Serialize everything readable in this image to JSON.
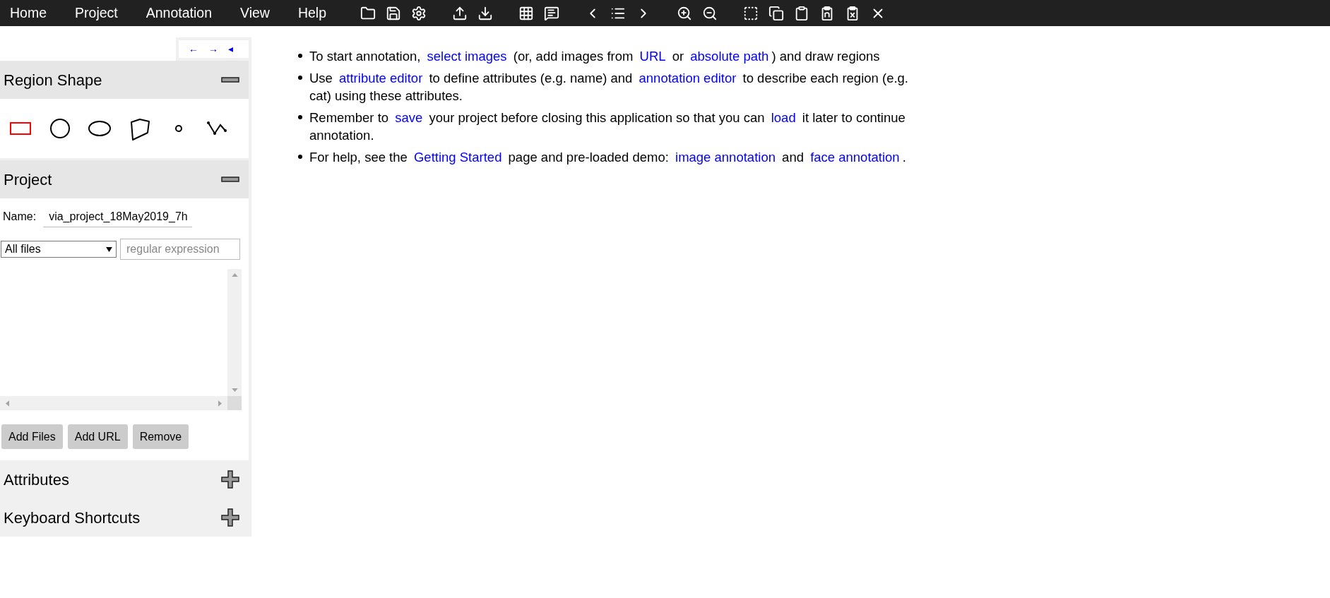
{
  "menu": [
    {
      "label": "Home"
    },
    {
      "label": "Project"
    },
    {
      "label": "Annotation"
    },
    {
      "label": "View"
    },
    {
      "label": "Help"
    }
  ],
  "panel_nav": [
    "←",
    "→",
    "◂"
  ],
  "region_shape": {
    "title": "Region Shape",
    "expanded": true,
    "shapes": [
      {
        "kind": "rect",
        "selected": true
      },
      {
        "kind": "circle",
        "selected": false
      },
      {
        "kind": "ellipse",
        "selected": false
      },
      {
        "kind": "polygon",
        "selected": false
      },
      {
        "kind": "point",
        "selected": false
      },
      {
        "kind": "polyline",
        "selected": false
      }
    ]
  },
  "project": {
    "title": "Project",
    "expanded": true,
    "name_label": "Name:",
    "name_value": "via_project_18May2019_7h",
    "filter": "All files",
    "regex_placeholder": "regular expression",
    "buttons": [
      "Add Files",
      "Add URL",
      "Remove"
    ]
  },
  "sections": [
    {
      "title": "Attributes",
      "expanded": false
    },
    {
      "title": "Keyboard Shortcuts",
      "expanded": false
    }
  ],
  "instructions": [
    [
      {
        "text": "To start annotation, ",
        "link": false
      },
      {
        "text": "select images",
        "link": true
      },
      {
        "text": " (or, add images from ",
        "link": false
      },
      {
        "text": "URL",
        "link": true
      },
      {
        "text": " or ",
        "link": false
      },
      {
        "text": "absolute path",
        "link": true
      },
      {
        "text": ") and draw regions",
        "link": false
      }
    ],
    [
      {
        "text": "Use ",
        "link": false
      },
      {
        "text": "attribute editor",
        "link": true
      },
      {
        "text": " to define attributes (e.g. name) and ",
        "link": false
      },
      {
        "text": "annotation editor",
        "link": true
      },
      {
        "text": " to describe each region (e.g. cat) using these attributes.",
        "link": false
      }
    ],
    [
      {
        "text": "Remember to ",
        "link": false
      },
      {
        "text": "save",
        "link": true
      },
      {
        "text": " your project before closing this application so that you can ",
        "link": false
      },
      {
        "text": "load",
        "link": true
      },
      {
        "text": " it later to continue annotation.",
        "link": false
      }
    ],
    [
      {
        "text": "For help, see the ",
        "link": false
      },
      {
        "text": "Getting Started",
        "link": true
      },
      {
        "text": " page and pre-loaded demo: ",
        "link": false
      },
      {
        "text": "image annotation",
        "link": true
      },
      {
        "text": " and ",
        "link": false
      },
      {
        "text": "face annotation",
        "link": true
      },
      {
        "text": ".",
        "link": false
      }
    ]
  ]
}
